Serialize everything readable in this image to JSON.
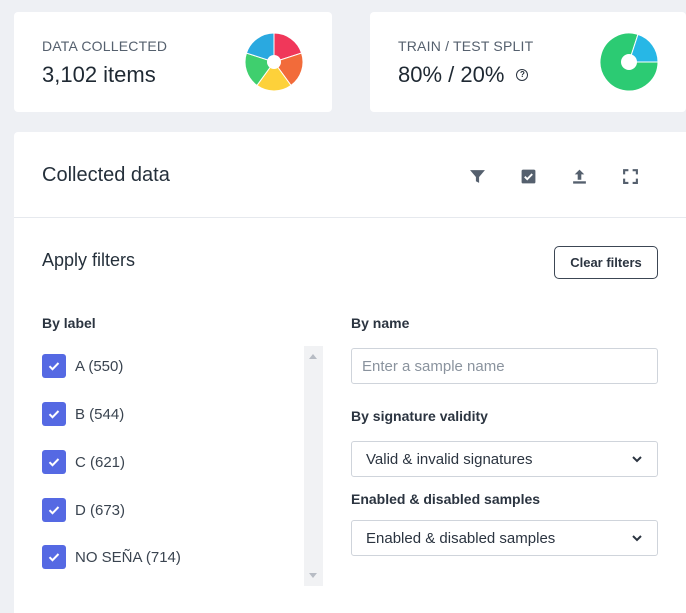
{
  "stats": {
    "collected": {
      "label": "DATA COLLECTED",
      "value": "3,102 items"
    },
    "split": {
      "label": "TRAIN / TEST SPLIT",
      "value": "80% / 20%",
      "help_icon": "question-circle-icon"
    }
  },
  "panel": {
    "title": "Collected data",
    "toolbar": [
      {
        "name": "filter-icon"
      },
      {
        "name": "select-all-icon"
      },
      {
        "name": "upload-icon"
      },
      {
        "name": "fullscreen-icon"
      }
    ]
  },
  "filters": {
    "title": "Apply filters",
    "clear_label": "Clear filters",
    "by_label": "By label",
    "labels": [
      {
        "text": "A (550)",
        "checked": true
      },
      {
        "text": "B (544)",
        "checked": true
      },
      {
        "text": "C (621)",
        "checked": true
      },
      {
        "text": "D (673)",
        "checked": true
      },
      {
        "text": "NO SEÑA (714)",
        "checked": true
      }
    ],
    "by_name": "By name",
    "name_placeholder": "Enter a sample name",
    "by_signature": "By signature validity",
    "signature_value": "Valid & invalid signatures",
    "enabled_label": "Enabled & disabled samples",
    "enabled_value": "Enabled & disabled samples"
  },
  "colors": {
    "accent": "#5569e3",
    "donut_collected": [
      "#f0375a",
      "#f26b3a",
      "#fdd13a",
      "#3fcf6e",
      "#2aa9e0"
    ],
    "donut_split": [
      "#2ccb73",
      "#27b7e6"
    ]
  }
}
